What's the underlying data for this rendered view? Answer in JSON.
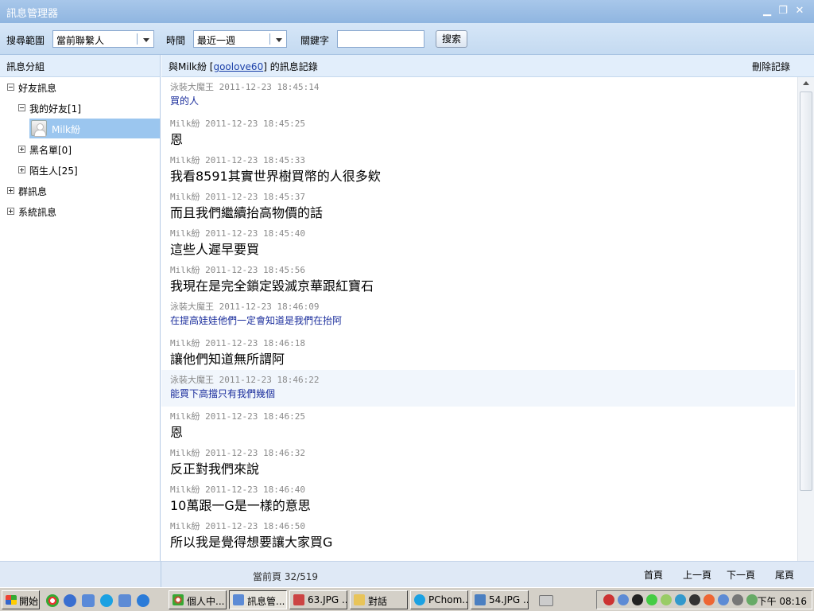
{
  "window": {
    "title": "訊息管理器"
  },
  "toolbar": {
    "range_label": "搜尋範圍",
    "range_value": "當前聯繫人",
    "time_label": "時間",
    "time_value": "最近一週",
    "keyword_label": "關鍵字",
    "keyword_value": "",
    "search_button": "搜索"
  },
  "tree": {
    "header": "訊息分組",
    "items": [
      {
        "label": "好友訊息"
      },
      {
        "label": "我的好友[1]"
      },
      {
        "label": "Milk紛"
      },
      {
        "label": "黑名單[0]"
      },
      {
        "label": "陌生人[25]"
      },
      {
        "label": "群訊息"
      },
      {
        "label": "系統訊息"
      }
    ]
  },
  "conversation": {
    "prefix": "與Milk紛 [",
    "contact_id": "goolove60",
    "suffix": "] 的訊息記錄",
    "delete_label": "刪除記錄"
  },
  "messages": [
    {
      "sender": "泳裝大魔王",
      "time": "2011-12-23 18:45:14",
      "text": "買的人"
    },
    {
      "sender": "Milk紛",
      "time": "2011-12-23 18:45:25",
      "text": "恩"
    },
    {
      "sender": "Milk紛",
      "time": "2011-12-23 18:45:33",
      "text": "我看8591其實世界樹買幣的人很多欸"
    },
    {
      "sender": "Milk紛",
      "time": "2011-12-23 18:45:37",
      "text": "而且我們繼續抬高物價的話"
    },
    {
      "sender": "Milk紛",
      "time": "2011-12-23 18:45:40",
      "text": "這些人遲早要買"
    },
    {
      "sender": "Milk紛",
      "time": "2011-12-23 18:45:56",
      "text": "我現在是完全鎖定毀滅京華跟紅寶石"
    },
    {
      "sender": "泳裝大魔王",
      "time": "2011-12-23 18:46:09",
      "text": "在提高娃娃他們一定會知道是我們在抬阿"
    },
    {
      "sender": "Milk紛",
      "time": "2011-12-23 18:46:18",
      "text": "讓他們知道無所謂阿"
    },
    {
      "sender": "泳裝大魔王",
      "time": "2011-12-23 18:46:22",
      "text": "能買下高擋只有我們幾個"
    },
    {
      "sender": "Milk紛",
      "time": "2011-12-23 18:46:25",
      "text": "恩"
    },
    {
      "sender": "Milk紛",
      "time": "2011-12-23 18:46:32",
      "text": "反正對我們來說"
    },
    {
      "sender": "Milk紛",
      "time": "2011-12-23 18:46:40",
      "text": "10萬跟一G是一樣的意思"
    },
    {
      "sender": "Milk紛",
      "time": "2011-12-23 18:46:50",
      "text": "所以我是覺得想要讓大家買G"
    }
  ],
  "footer": {
    "page_info": "當前頁 32/519",
    "first": "首頁",
    "prev": "上一頁",
    "next": "下一頁",
    "last": "尾頁"
  },
  "taskbar": {
    "start": "開始",
    "tasks": [
      {
        "label": "個人中..."
      },
      {
        "label": "訊息管..."
      },
      {
        "label": "63.JPG ..."
      },
      {
        "label": "對話"
      },
      {
        "label": "PChom..."
      },
      {
        "label": "54.JPG ..."
      }
    ],
    "clock": "下午 08:16"
  },
  "colors": {
    "self_text": "#1a2d9c",
    "selected": "#9bc6ef",
    "titlebar": "#8fb5e0"
  }
}
